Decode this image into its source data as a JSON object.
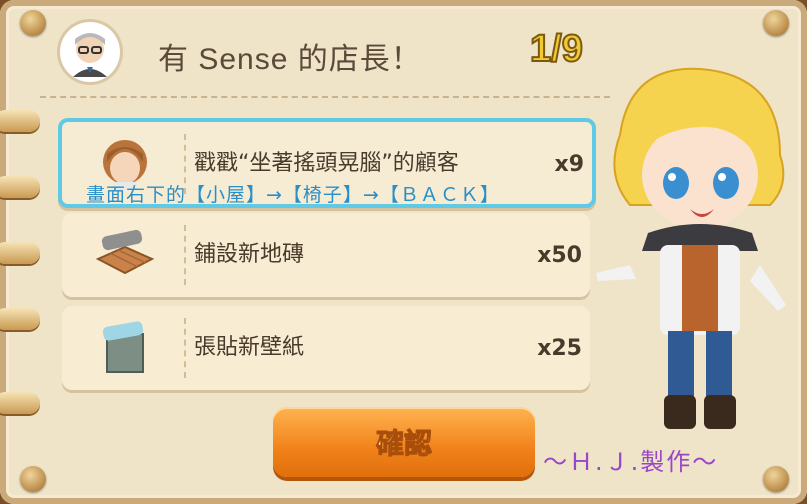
{
  "header": {
    "title": "有 Sense 的店長！",
    "progress": "1/9",
    "avatar_icon": "gray-haired-manager-avatar"
  },
  "tasks": [
    {
      "label": "戳戳“坐著搖頭晃腦”的顧客",
      "qty": "x9",
      "icon": "customer-head-icon",
      "active": true
    },
    {
      "label": "鋪設新地磚",
      "qty": "x50",
      "icon": "new-floor-tile-icon",
      "active": false
    },
    {
      "label": "張貼新壁紙",
      "qty": "x25",
      "icon": "new-wallpaper-icon",
      "active": false
    }
  ],
  "overlay_hint": "畫面右下的【小屋】→【椅子】→【ＢＡＣＫ】",
  "confirm_label": "確認",
  "credit": "～Ｈ.Ｊ.製作～",
  "colors": {
    "accent": "#f1821a",
    "highlight": "#5fc9e6",
    "hint_text": "#2a8fc8",
    "credit": "#9a46c8"
  }
}
